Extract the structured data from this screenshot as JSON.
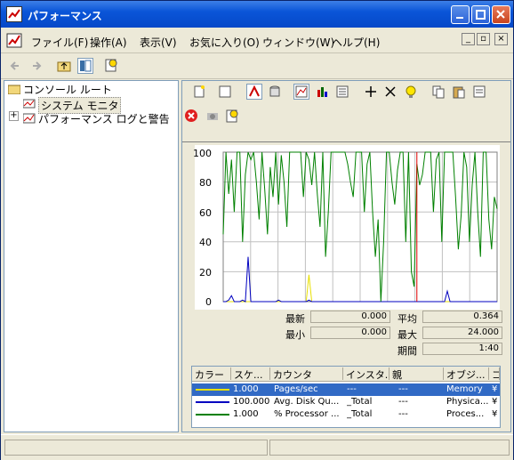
{
  "window": {
    "title": "パフォーマンス"
  },
  "menu": [
    {
      "label": "ファイル(F)"
    },
    {
      "label": "操作(A)"
    },
    {
      "label": "表示(V)"
    },
    {
      "label": "お気に入り(O)"
    },
    {
      "label": "ウィンドウ(W)"
    },
    {
      "label": "ヘルプ(H)"
    }
  ],
  "tree": {
    "root": "コンソール ルート",
    "items": [
      {
        "label": "システム モニタ"
      },
      {
        "label": "パフォーマンス ログと警告"
      }
    ]
  },
  "chart_data": {
    "type": "line",
    "ylim": [
      0,
      100
    ],
    "yticks": [
      "100",
      "80",
      "60",
      "40",
      "20",
      "0"
    ],
    "series": [
      {
        "name": "Pages/sec",
        "color": "#e8e000",
        "values": [
          0,
          0,
          0,
          0,
          0,
          0,
          0,
          0,
          0,
          0,
          0,
          0,
          0,
          0,
          0,
          0,
          0,
          0,
          0,
          0,
          0,
          0,
          0,
          0,
          0,
          0,
          0,
          0,
          0,
          0,
          0,
          18,
          0,
          0,
          0,
          0,
          0,
          0,
          0,
          0,
          0,
          0,
          0,
          0,
          0,
          0,
          0,
          0,
          0,
          0,
          0,
          0,
          0,
          0,
          0,
          0,
          0,
          0,
          0,
          0,
          0,
          0,
          0,
          0,
          0,
          0,
          0,
          0,
          0,
          0,
          0,
          0,
          0,
          0,
          0,
          0,
          0,
          0,
          0,
          0,
          0,
          0,
          0,
          0,
          0,
          0,
          0,
          0,
          0,
          0,
          0,
          0,
          0,
          0,
          0,
          0,
          0,
          0,
          0,
          0
        ]
      },
      {
        "name": "Avg. Disk Qu...",
        "color": "#0000c0",
        "values": [
          0,
          0,
          1,
          4,
          0,
          0,
          0,
          1,
          0,
          30,
          0,
          0,
          0,
          0,
          0,
          0,
          0,
          0,
          0,
          0,
          1,
          0,
          0,
          0,
          0,
          0,
          0,
          0,
          0,
          0,
          0,
          1,
          0,
          0,
          0,
          0,
          0,
          0,
          0,
          0,
          0,
          0,
          0,
          0,
          0,
          0,
          0,
          0,
          0,
          0,
          0,
          0,
          0,
          0,
          0,
          0,
          0,
          0,
          0,
          0,
          0,
          0,
          0,
          0,
          0,
          0,
          0,
          0,
          0,
          0,
          0,
          0,
          0,
          0,
          0,
          0,
          0,
          0,
          0,
          0,
          0,
          7,
          0,
          0,
          0,
          0,
          0,
          0,
          0,
          0,
          0,
          0,
          0,
          0,
          0,
          0,
          0,
          0,
          0,
          0
        ]
      },
      {
        "name": "% Processor ...",
        "color": "#008000",
        "values": [
          45,
          100,
          72,
          95,
          60,
          100,
          100,
          40,
          85,
          100,
          95,
          100,
          80,
          55,
          100,
          75,
          45,
          90,
          70,
          100,
          65,
          98,
          80,
          50,
          100,
          100,
          100,
          100,
          100,
          70,
          100,
          95,
          78,
          100,
          72,
          50,
          100,
          30,
          60,
          100,
          100,
          100,
          100,
          100,
          100,
          92,
          80,
          70,
          100,
          100,
          100,
          60,
          92,
          100,
          60,
          30,
          55,
          0,
          40,
          100,
          100,
          80,
          65,
          88,
          100,
          100,
          40,
          100,
          20,
          10,
          92,
          78,
          85,
          100,
          100,
          100,
          60,
          95,
          100,
          40,
          100,
          100,
          100,
          100,
          70,
          35,
          58,
          100,
          90,
          40,
          78,
          100,
          60,
          30,
          100,
          100,
          55,
          35,
          70,
          62
        ]
      }
    ],
    "cursor_index": 70
  },
  "stats": {
    "last_label": "最新",
    "last_value": "0.000",
    "avg_label": "平均",
    "avg_value": "0.364",
    "min_label": "最小",
    "min_value": "0.000",
    "max_label": "最大",
    "max_value": "24.000",
    "period_label": "期間",
    "period_value": "1:40"
  },
  "counter_list": {
    "headers": [
      "カラー",
      "スケ...",
      "カウンタ",
      "インスタ...",
      "親",
      "オブジ...",
      "コ"
    ],
    "rows": [
      {
        "color": "#e8e000",
        "scale": "1.000",
        "counter": "Pages/sec",
        "instance": "---",
        "parent": "---",
        "object": "Memory",
        "computer": "¥"
      },
      {
        "color": "#0000c0",
        "scale": "100.000",
        "counter": "Avg. Disk Qu...",
        "instance": "_Total",
        "parent": "---",
        "object": "Physica...",
        "computer": "¥"
      },
      {
        "color": "#008000",
        "scale": "1.000",
        "counter": "% Processor ...",
        "instance": "_Total",
        "parent": "---",
        "object": "Proces...",
        "computer": "¥"
      }
    ]
  }
}
